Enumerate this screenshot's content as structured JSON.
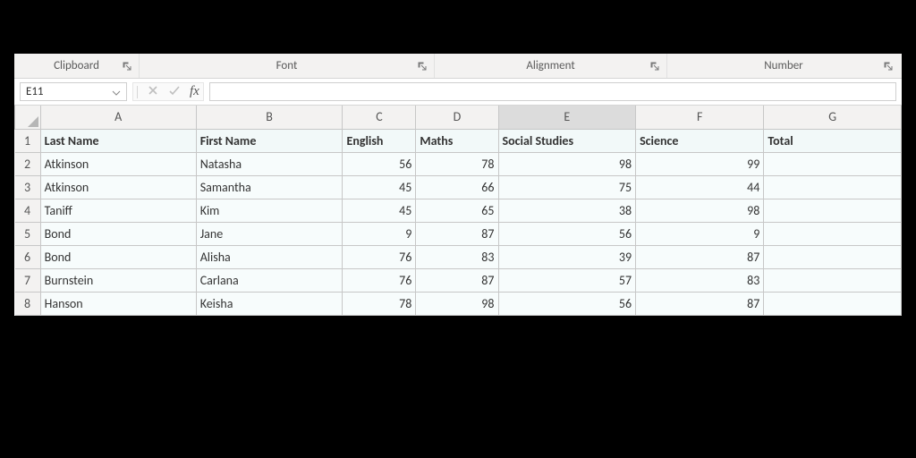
{
  "ribbon": {
    "groups": {
      "clipboard": "Clipboard",
      "font": "Font",
      "alignment": "Alignment",
      "number": "Number"
    }
  },
  "formula_bar": {
    "name_box": "E11",
    "fx_label": "fx",
    "formula_value": ""
  },
  "columns": [
    "A",
    "B",
    "C",
    "D",
    "E",
    "F",
    "G"
  ],
  "selected_column": "E",
  "chart_data": {
    "type": "table",
    "headers": [
      "Last Name",
      "First Name",
      "English",
      "Maths",
      "Social Studies",
      "Science",
      "Total"
    ],
    "rows": [
      {
        "num": "2",
        "last": "Atkinson",
        "first": "Natasha",
        "english": "56",
        "maths": "78",
        "social": "98",
        "science": "99",
        "total": ""
      },
      {
        "num": "3",
        "last": "Atkinson",
        "first": "Samantha",
        "english": "45",
        "maths": "66",
        "social": "75",
        "science": "44",
        "total": ""
      },
      {
        "num": "4",
        "last": "Taniff",
        "first": "Kim",
        "english": "45",
        "maths": "65",
        "social": "38",
        "science": "98",
        "total": ""
      },
      {
        "num": "5",
        "last": "Bond",
        "first": "Jane",
        "english": "9",
        "maths": "87",
        "social": "56",
        "science": "9",
        "total": ""
      },
      {
        "num": "6",
        "last": "Bond",
        "first": "Alisha",
        "english": "76",
        "maths": "83",
        "social": "39",
        "science": "87",
        "total": ""
      },
      {
        "num": "7",
        "last": "Burnstein",
        "first": "Carlana",
        "english": "76",
        "maths": "87",
        "social": "57",
        "science": "83",
        "total": ""
      },
      {
        "num": "8",
        "last": "Hanson",
        "first": "Keisha",
        "english": "78",
        "maths": "98",
        "social": "56",
        "science": "87",
        "total": ""
      }
    ]
  }
}
